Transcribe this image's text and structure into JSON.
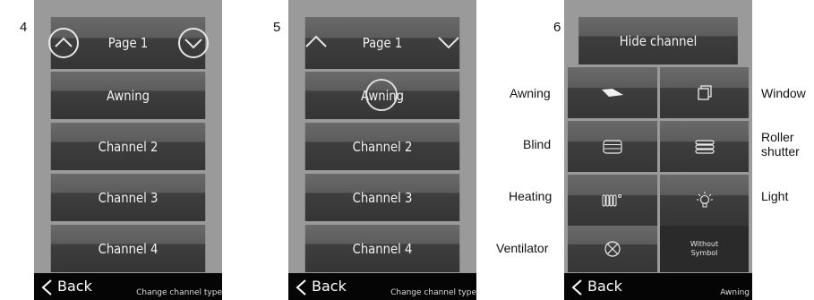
{
  "screens": [
    {
      "step": "4",
      "header": "Page 1",
      "channels": [
        "Awning",
        "Channel 2",
        "Channel 3",
        "Channel 4"
      ],
      "back_label": "Back",
      "caption": "Change channel type"
    },
    {
      "step": "5",
      "header": "Page 1",
      "channels": [
        "Awning",
        "Channel 2",
        "Channel 3",
        "Channel 4"
      ],
      "back_label": "Back",
      "caption": "Change channel type"
    },
    {
      "step": "6",
      "header": "Hide channel",
      "types": {
        "awning": "Awning",
        "window": "Window",
        "blind": "Blind",
        "roller_shutter": "Roller shutter",
        "heating": "Heating",
        "light": "Light",
        "ventilator": "Ventilator",
        "without_symbol": "Without Symbol"
      },
      "back_label": "Back",
      "caption": "Awning"
    }
  ]
}
